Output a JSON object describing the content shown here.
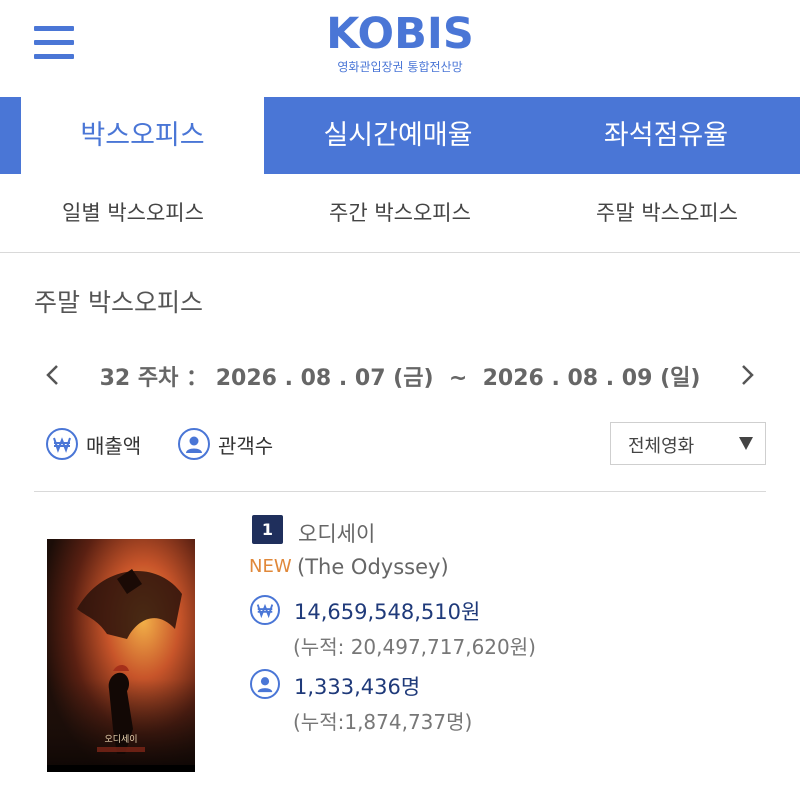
{
  "header": {
    "logo_text": "KOBIS",
    "logo_subtitle": "영화관입장권 통합전산망",
    "menu_icon": "hamburger-menu-icon",
    "brand_color": "#4a76d6"
  },
  "main_tabs": [
    {
      "label": "박스오피스",
      "active": true
    },
    {
      "label": "실시간예매율",
      "active": false
    },
    {
      "label": "좌석점유율",
      "active": false
    }
  ],
  "sub_tabs": [
    {
      "label": "일별 박스오피스"
    },
    {
      "label": "주간 박스오피스"
    },
    {
      "label": "주말 박스오피스"
    }
  ],
  "section": {
    "title": "주말 박스오피스"
  },
  "week_nav": {
    "week": "32 주차",
    "separator": "：",
    "range": "2026 . 08 . 07 (금)  ~  2026 . 08 . 09 (일)",
    "prev_icon": "chevron-left-icon",
    "next_icon": "chevron-right-icon"
  },
  "filters": {
    "sales_label": "매출액",
    "audience_label": "관객수",
    "select_value": "전체영화"
  },
  "movies": [
    {
      "rank": "1",
      "title_kr": "오디세이",
      "badge": "NEW",
      "title_en": "(The Odyssey)",
      "sales": "14,659,548,510원",
      "sales_cumulative": "(누적: 20,497,717,620원)",
      "audience": "1,333,436명",
      "audience_cumulative": "(누적:1,874,737명)",
      "poster_text": "오디세이"
    }
  ],
  "colors": {
    "accent": "#4a76d6",
    "rank_badge": "#1f2f5c",
    "new_badge": "#e0883a",
    "value_text": "#1f3a7a"
  }
}
